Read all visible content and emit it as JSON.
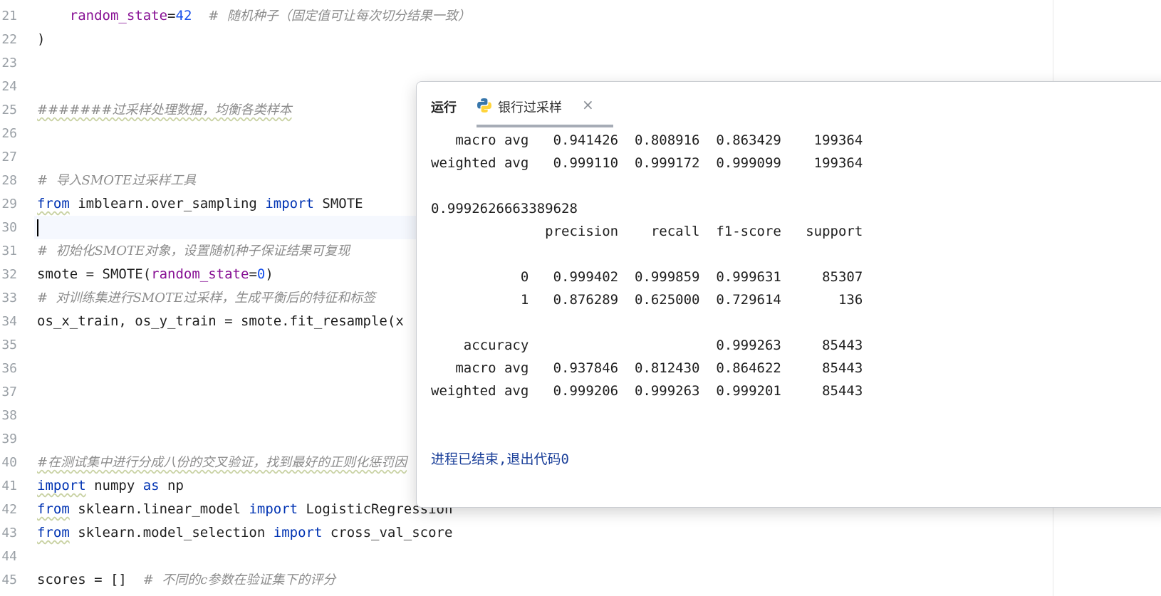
{
  "editor": {
    "lines": [
      {
        "n": "21",
        "segments": [
          {
            "t": "    "
          },
          {
            "t": "random_state",
            "c": "prm"
          },
          {
            "t": "="
          },
          {
            "t": "42",
            "c": "num"
          },
          {
            "t": "  "
          },
          {
            "t": "#  随机种子（固定值可让每次切分结果一致）",
            "c": "cmt"
          }
        ]
      },
      {
        "n": "22",
        "segments": [
          {
            "t": ")"
          }
        ]
      },
      {
        "n": "23",
        "segments": []
      },
      {
        "n": "24",
        "segments": []
      },
      {
        "n": "25",
        "segments": [
          {
            "t": "#######过采样处理数据，均衡各类样本",
            "c": "cmt wavy"
          }
        ]
      },
      {
        "n": "26",
        "segments": []
      },
      {
        "n": "27",
        "segments": []
      },
      {
        "n": "28",
        "segments": [
          {
            "t": "#  导入SMOTE过采样工具",
            "c": "cmt"
          }
        ]
      },
      {
        "n": "29",
        "segments": [
          {
            "t": "from",
            "c": "kw wavy"
          },
          {
            "t": " imblearn.over_sampling "
          },
          {
            "t": "import",
            "c": "kw"
          },
          {
            "t": " SMOTE"
          }
        ]
      },
      {
        "n": "30",
        "segments": [],
        "current": true
      },
      {
        "n": "31",
        "segments": [
          {
            "t": "#  初始化SMOTE对象，设置随机种子保证结果可复现",
            "c": "cmt"
          }
        ]
      },
      {
        "n": "32",
        "segments": [
          {
            "t": "smote = SMOTE("
          },
          {
            "t": "random_state",
            "c": "prm"
          },
          {
            "t": "="
          },
          {
            "t": "0",
            "c": "num"
          },
          {
            "t": ")"
          }
        ]
      },
      {
        "n": "33",
        "segments": [
          {
            "t": "#  对训练集进行SMOTE过采样，生成平衡后的特征和标签",
            "c": "cmt"
          }
        ]
      },
      {
        "n": "34",
        "segments": [
          {
            "t": "os_x_train, os_y_train = smote.fit_resample(x"
          }
        ]
      },
      {
        "n": "35",
        "segments": []
      },
      {
        "n": "36",
        "segments": []
      },
      {
        "n": "37",
        "segments": []
      },
      {
        "n": "38",
        "segments": []
      },
      {
        "n": "39",
        "segments": []
      },
      {
        "n": "40",
        "segments": [
          {
            "t": "#在测试集中进行分成八份的交叉验证，找到最好的正则化惩罚因",
            "c": "cmt wavy"
          }
        ]
      },
      {
        "n": "41",
        "segments": [
          {
            "t": "import",
            "c": "kw wavy"
          },
          {
            "t": " numpy "
          },
          {
            "t": "as",
            "c": "kw"
          },
          {
            "t": " np"
          }
        ]
      },
      {
        "n": "42",
        "segments": [
          {
            "t": "from",
            "c": "kw wavy"
          },
          {
            "t": " sklearn.linear_model "
          },
          {
            "t": "import",
            "c": "kw"
          },
          {
            "t": " LogisticRegression"
          }
        ]
      },
      {
        "n": "43",
        "segments": [
          {
            "t": "from",
            "c": "kw wavy"
          },
          {
            "t": " sklearn.model_selection "
          },
          {
            "t": "import",
            "c": "kw"
          },
          {
            "t": " cross_val_score"
          }
        ]
      },
      {
        "n": "44",
        "segments": []
      },
      {
        "n": "45",
        "segments": [
          {
            "t": "scores = []  "
          },
          {
            "t": "#  不同的c参数在验证集下的评分",
            "c": "cmt"
          }
        ]
      }
    ]
  },
  "run_panel": {
    "run_label": "运行",
    "tab_title": "银行过采样",
    "close_glyph": "×",
    "python_icon_colors": {
      "blue": "#3776ab",
      "yellow": "#ffd43b"
    },
    "output": [
      {
        "text": "   macro avg   0.941426  0.808916  0.863429    199364"
      },
      {
        "text": "weighted avg   0.999110  0.999172  0.999099    199364"
      },
      {
        "text": ""
      },
      {
        "text": "0.9992626663389628"
      },
      {
        "text": "              precision    recall  f1-score   support"
      },
      {
        "text": ""
      },
      {
        "text": "           0   0.999402  0.999859  0.999631     85307"
      },
      {
        "text": "           1   0.876289  0.625000  0.729614       136"
      },
      {
        "text": ""
      },
      {
        "text": "    accuracy                       0.999263     85443"
      },
      {
        "text": "   macro avg   0.937846  0.812430  0.864622     85443"
      },
      {
        "text": "weighted avg   0.999206  0.999263  0.999201     85443"
      },
      {
        "text": ""
      },
      {
        "text": ""
      },
      {
        "text": "进程已结束,退出代码0",
        "kind": "exit"
      }
    ]
  }
}
